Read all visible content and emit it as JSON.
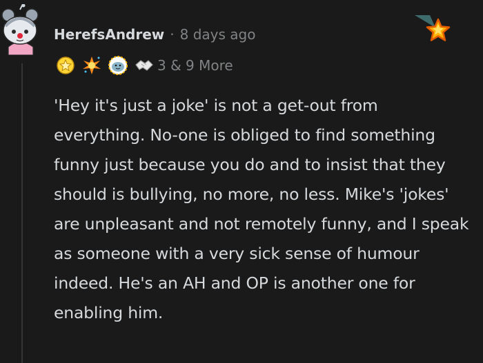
{
  "comment": {
    "author": "HerefsAndrew",
    "separator": "·",
    "timestamp": "8 days ago",
    "award_count_text": "3 & 9 More",
    "awards": [
      {
        "icon": "gold-badge-icon"
      },
      {
        "icon": "starburst-award-icon"
      },
      {
        "icon": "wholesome-seal-award-icon"
      },
      {
        "icon": "handshake-award-icon"
      }
    ],
    "body": "'Hey it's just a joke' is not a get-out from everything. No-one is obliged to find something funny just because you do and to insist that they should is bullying, no more, no less. Mike's 'jokes' are unpleasant and not remotely funny, and I speak as someone with a very sick sense of humour indeed. He's an AH and OP is another one for enabling him."
  },
  "colors": {
    "background": "#1a1a1b",
    "text_primary": "#d7dadc",
    "text_muted": "#818384",
    "thread_line": "#343536",
    "award_orange": "#ff8c1a",
    "award_gold": "#ffd635"
  }
}
